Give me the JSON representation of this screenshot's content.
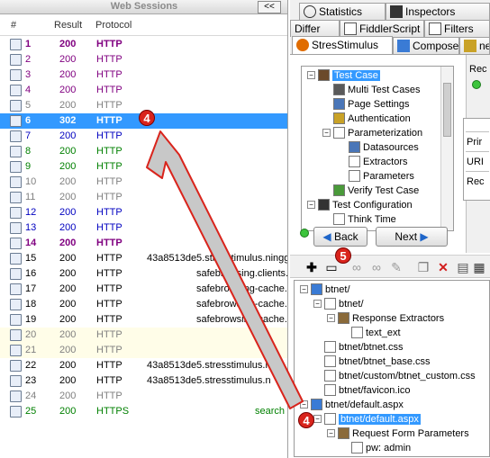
{
  "web_sessions": {
    "title": "Web Sessions",
    "collapse_label": "<<",
    "columns": [
      "#",
      "Result",
      "Protocol"
    ],
    "rows": [
      {
        "num": "1",
        "result": "200",
        "protocol": "HTTP",
        "host": "",
        "color": "#800080",
        "bold": true,
        "icon": "page-icon"
      },
      {
        "num": "2",
        "result": "200",
        "protocol": "HTTP",
        "host": "",
        "color": "#800080",
        "bold": false,
        "icon": "script-icon"
      },
      {
        "num": "3",
        "result": "200",
        "protocol": "HTTP",
        "host": "",
        "color": "#800080",
        "bold": false,
        "icon": "script-icon"
      },
      {
        "num": "4",
        "result": "200",
        "protocol": "HTTP",
        "host": "",
        "color": "#800080",
        "bold": false,
        "icon": "script-icon"
      },
      {
        "num": "5",
        "result": "200",
        "protocol": "HTTP",
        "host": "",
        "color": "#808080",
        "bold": false,
        "icon": "image-icon"
      },
      {
        "num": "6",
        "result": "302",
        "protocol": "HTTP",
        "host": "",
        "color": "#ffffff",
        "bold": true,
        "icon": "redirect-icon",
        "selected": true
      },
      {
        "num": "7",
        "result": "200",
        "protocol": "HTTP",
        "host": "",
        "color": "#0000c0",
        "bold": false,
        "icon": "page-icon"
      },
      {
        "num": "8",
        "result": "200",
        "protocol": "HTTP",
        "host": "",
        "color": "#008000",
        "bold": false,
        "icon": "script-icon"
      },
      {
        "num": "9",
        "result": "200",
        "protocol": "HTTP",
        "host": "",
        "color": "#008000",
        "bold": false,
        "icon": "script-icon"
      },
      {
        "num": "10",
        "result": "200",
        "protocol": "HTTP",
        "host": "",
        "color": "#808080",
        "bold": false,
        "icon": "image-icon"
      },
      {
        "num": "11",
        "result": "200",
        "protocol": "HTTP",
        "host": "",
        "color": "#808080",
        "bold": false,
        "icon": "image-icon"
      },
      {
        "num": "12",
        "result": "200",
        "protocol": "HTTP",
        "host": "",
        "color": "#0000c0",
        "bold": false,
        "icon": "page-icon"
      },
      {
        "num": "13",
        "result": "200",
        "protocol": "HTTP",
        "host": "",
        "color": "#0000c0",
        "bold": false,
        "icon": "page-icon"
      },
      {
        "num": "14",
        "result": "200",
        "protocol": "HTTP",
        "host": "",
        "color": "#800080",
        "bold": true,
        "icon": "arrow-icon"
      },
      {
        "num": "15",
        "result": "200",
        "protocol": "HTTP",
        "host": "43a8513de5.stresstimulus.ningg",
        "color": "#000000",
        "bold": false,
        "icon": "json-icon"
      },
      {
        "num": "16",
        "result": "200",
        "protocol": "HTTP",
        "host": "safebrowsing.clients.",
        "color": "#000000",
        "bold": false,
        "icon": "doc-icon"
      },
      {
        "num": "17",
        "result": "200",
        "protocol": "HTTP",
        "host": "safebrowsing-cache.",
        "color": "#000000",
        "bold": false,
        "icon": "doc-icon"
      },
      {
        "num": "18",
        "result": "200",
        "protocol": "HTTP",
        "host": "safebrowsing-cache.",
        "color": "#000000",
        "bold": false,
        "icon": "doc-icon"
      },
      {
        "num": "19",
        "result": "200",
        "protocol": "HTTP",
        "host": "safebrowsing-cache.",
        "color": "#000000",
        "bold": false,
        "icon": "doc-icon"
      },
      {
        "num": "20",
        "result": "200",
        "protocol": "HTTP",
        "host": "",
        "color": "#808080",
        "bold": false,
        "icon": "lock-icon",
        "bg": "#fffde8"
      },
      {
        "num": "21",
        "result": "200",
        "protocol": "HTTP",
        "host": "",
        "color": "#808080",
        "bold": false,
        "icon": "lock-icon",
        "bg": "#fffde8"
      },
      {
        "num": "22",
        "result": "200",
        "protocol": "HTTP",
        "host": "43a8513de5.stresstimulus.n",
        "color": "#000000",
        "bold": false,
        "icon": "json-icon"
      },
      {
        "num": "23",
        "result": "200",
        "protocol": "HTTP",
        "host": "43a8513de5.stresstimulus.n",
        "color": "#000000",
        "bold": false,
        "icon": "json-icon"
      },
      {
        "num": "24",
        "result": "200",
        "protocol": "HTTP",
        "host": "",
        "color": "#808080",
        "bold": false,
        "icon": "image-icon"
      },
      {
        "num": "25",
        "result": "200",
        "protocol": "HTTPS",
        "host": "search",
        "color": "#008000",
        "bold": false,
        "icon": "script-icon"
      }
    ]
  },
  "tabs": {
    "statistics": "Statistics",
    "inspectors": "Inspectors",
    "differ": "Differ",
    "fiddlerscript": "FiddlerScript",
    "filters": "Filters",
    "stresstimulus": "StresStimulus",
    "composer": "Composer",
    "ne": "ne"
  },
  "side_label": "Rec",
  "test_tree": [
    {
      "label": "Test Case",
      "depth": 0,
      "icon": "briefcase-icon",
      "expander": "−",
      "selected": true
    },
    {
      "label": "Multi Test Cases",
      "depth": 1,
      "icon": "multi-case-icon"
    },
    {
      "label": "Page Settings",
      "depth": 1,
      "icon": "page-settings-icon"
    },
    {
      "label": "Authentication",
      "depth": 1,
      "icon": "user-lock-icon"
    },
    {
      "label": "Parameterization",
      "depth": 1,
      "icon": "braces-icon",
      "expander": "−"
    },
    {
      "label": "Datasources",
      "depth": 2,
      "icon": "datasource-icon"
    },
    {
      "label": "Extractors",
      "depth": 2,
      "icon": "pencil-icon"
    },
    {
      "label": "Parameters",
      "depth": 2,
      "icon": "parameter-icon"
    },
    {
      "label": "Verify Test Case",
      "depth": 1,
      "icon": "verify-icon"
    },
    {
      "label": "Test Configuration",
      "depth": 0,
      "icon": "wrench-icon",
      "expander": "−"
    },
    {
      "label": "Think Time",
      "depth": 1,
      "icon": "hourglass-icon"
    }
  ],
  "nav": {
    "back": "Back",
    "next": "Next"
  },
  "side_items": [
    "Prir",
    "URI",
    "Rec"
  ],
  "bottom_tree": [
    {
      "label": "btnet/",
      "depth": 0,
      "icon": "globe-page-icon",
      "expander": "−"
    },
    {
      "label": "btnet/",
      "depth": 1,
      "icon": "link-icon",
      "expander": "−"
    },
    {
      "label": "Response Extractors",
      "depth": 2,
      "icon": "extractor-icon",
      "expander": "−"
    },
    {
      "label": "text_ext",
      "depth": 3,
      "icon": "pencil-icon"
    },
    {
      "label": "btnet/btnet.css",
      "depth": 1,
      "icon": "link-icon"
    },
    {
      "label": "btnet/btnet_base.css",
      "depth": 1,
      "icon": "link-icon"
    },
    {
      "label": "btnet/custom/btnet_custom.css",
      "depth": 1,
      "icon": "link-icon"
    },
    {
      "label": "btnet/favicon.ico",
      "depth": 1,
      "icon": "link-icon"
    },
    {
      "label": "btnet/default.aspx",
      "depth": 0,
      "icon": "globe-page-icon",
      "expander": "−"
    },
    {
      "label": "btnet/default.aspx",
      "depth": 1,
      "icon": "link-icon",
      "expander": "−",
      "selected": true
    },
    {
      "label": "Request Form Parameters",
      "depth": 2,
      "icon": "extractor-icon",
      "expander": "−"
    },
    {
      "label": "pw: admin",
      "depth": 3,
      "icon": "param-px-icon"
    }
  ],
  "badges": {
    "a": "4",
    "b": "4",
    "c": "5"
  },
  "colors": {
    "selection": "#3399ff",
    "badge": "#d9241c",
    "arrow_fill": "#c8c8c8",
    "arrow_stroke": "#d9241c"
  }
}
